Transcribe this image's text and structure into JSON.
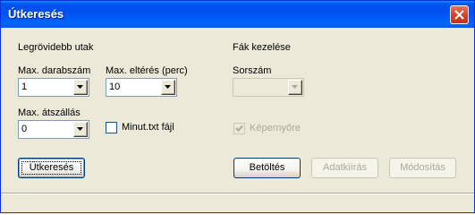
{
  "window": {
    "title": "Útkeresés"
  },
  "shortest_paths": {
    "heading": "Legrövidebb utak",
    "max_count_label": "Max. darabszám",
    "max_count_value": "1",
    "max_deviation_label": "Max. eltérés (perc)",
    "max_deviation_value": "10",
    "max_transfers_label": "Max. átszállás",
    "max_transfers_value": "0",
    "minut_file_label": "Minut.txt fájl",
    "minut_file_checked": false
  },
  "tree_management": {
    "heading": "Fák kezelése",
    "serial_label": "Sorszám",
    "serial_value": "",
    "screen_label": "Képernyőre",
    "screen_checked": true
  },
  "buttons": {
    "search": "Útkeresés",
    "load": "Betöltés",
    "write_data": "Adatkiírás",
    "modify": "Módosítás"
  }
}
